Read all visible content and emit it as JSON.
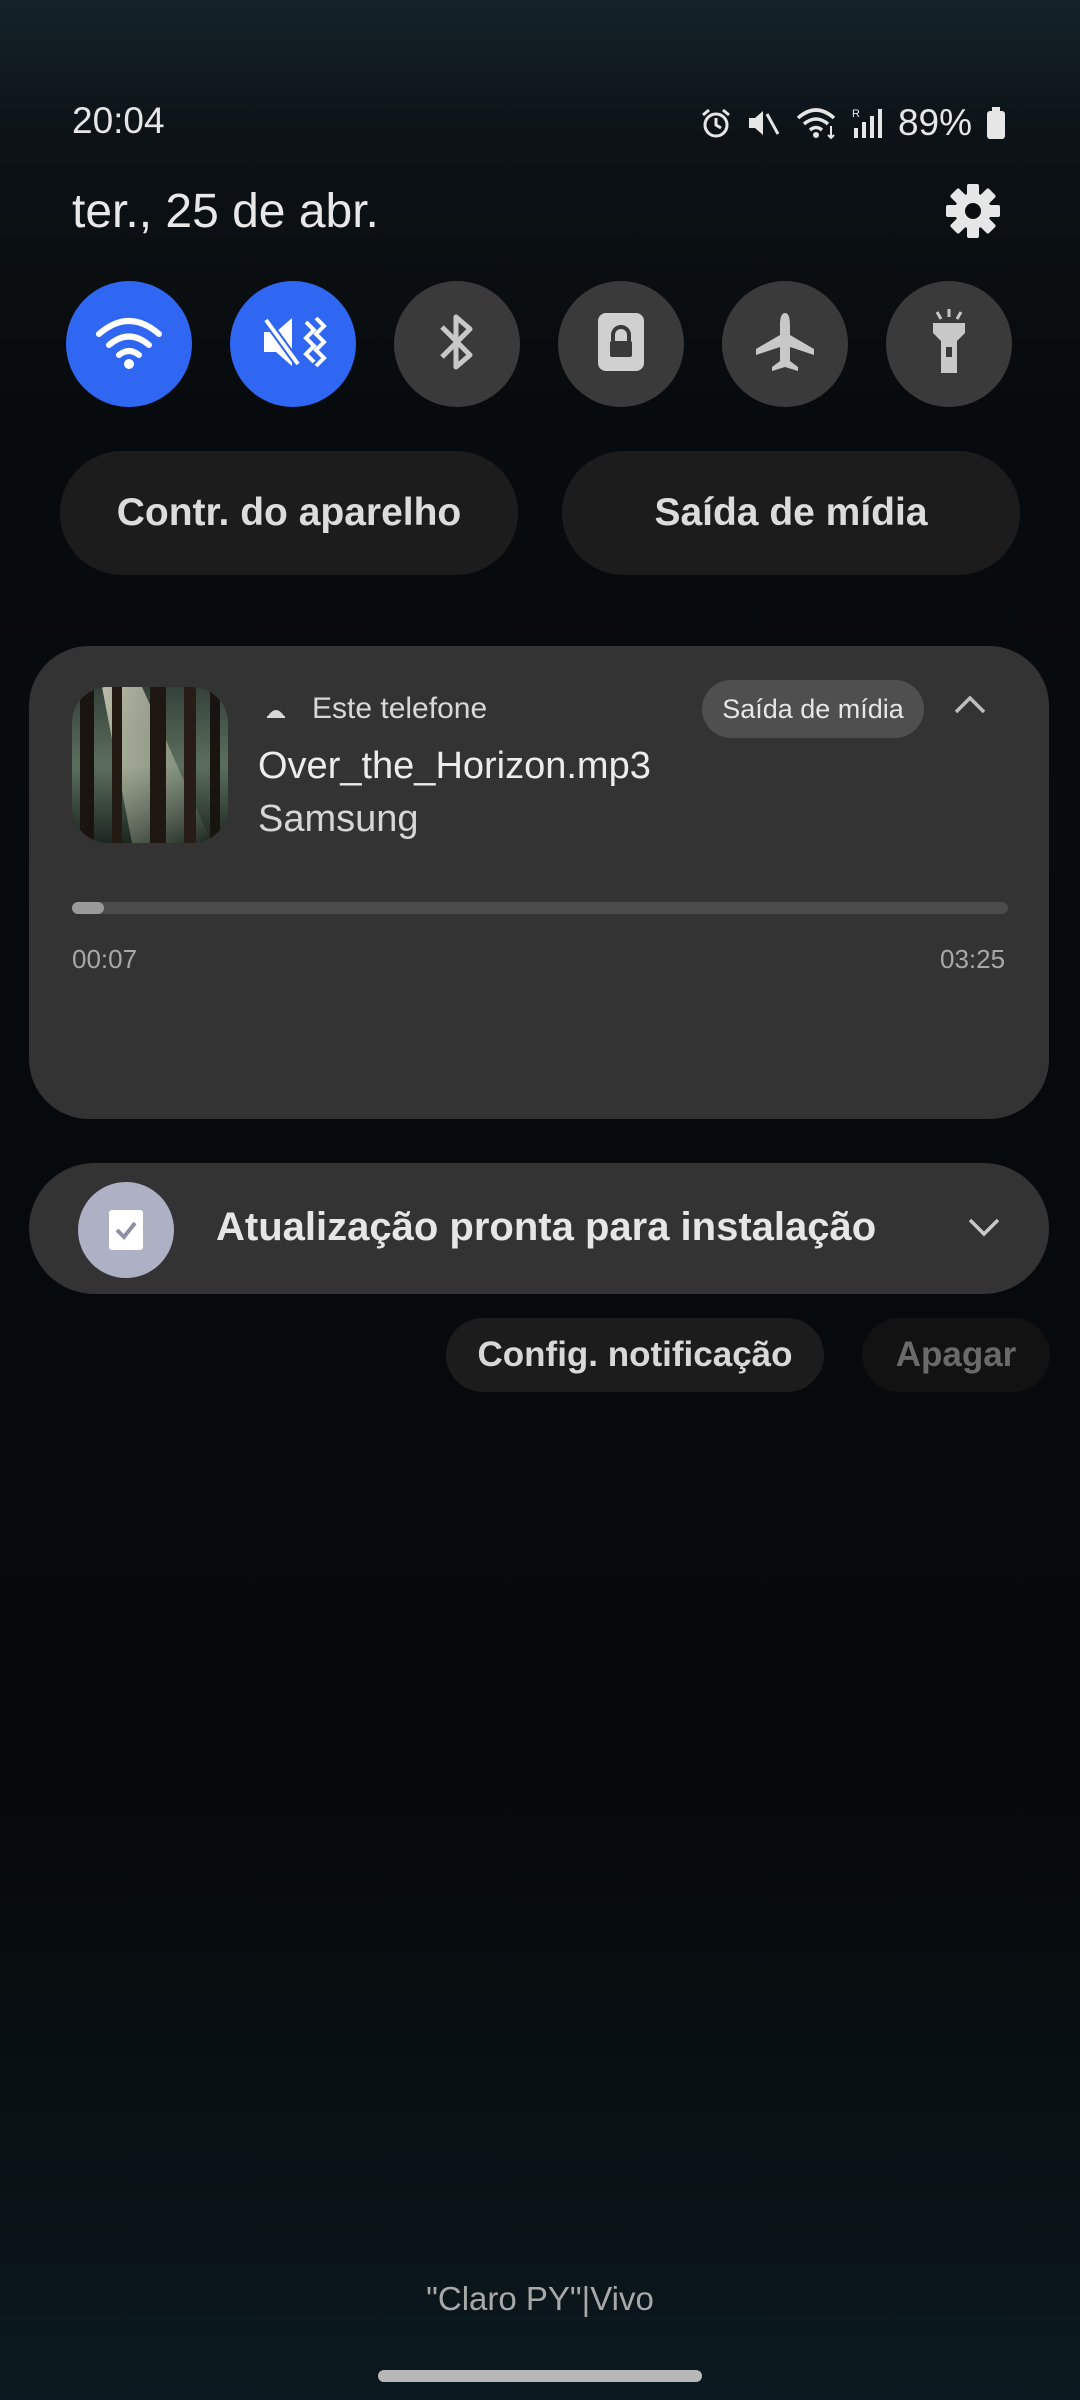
{
  "status_bar": {
    "time": "20:04",
    "battery": "89%",
    "icons": [
      "alarm-icon",
      "mute-icon",
      "wifi-icon",
      "signal-icon",
      "battery-icon"
    ]
  },
  "header": {
    "date": "ter., 25 de abr.",
    "settings_icon": "gear-icon"
  },
  "quick_toggles": [
    {
      "name": "wifi",
      "icon": "wifi-icon",
      "active": true
    },
    {
      "name": "sound",
      "icon": "mute-icon",
      "active": true
    },
    {
      "name": "bluetooth",
      "icon": "bluetooth-icon",
      "active": false
    },
    {
      "name": "screen-lock",
      "icon": "lock-icon",
      "active": false
    },
    {
      "name": "airplane",
      "icon": "airplane-icon",
      "active": false
    },
    {
      "name": "flashlight",
      "icon": "flashlight-icon",
      "active": false
    }
  ],
  "pills": {
    "device_control": "Contr. do aparelho",
    "media_output": "Saída de mídia"
  },
  "media": {
    "device_label": "Este telefone",
    "output_chip": "Saída de mídia",
    "title": "Over_the_Horizon.mp3",
    "artist": "Samsung",
    "elapsed": "00:07",
    "duration": "03:25",
    "progress": 0.034
  },
  "notification": {
    "text": "Atualização pronta para instalação",
    "icon": "checklist-icon"
  },
  "actions": {
    "config": "Config. notificação",
    "clear": "Apagar"
  },
  "carrier": "\"Claro PY\"|Vivo",
  "colors": {
    "accent": "#2f66f2",
    "card": "#333333",
    "toggle_off": "#3a3a3a"
  }
}
